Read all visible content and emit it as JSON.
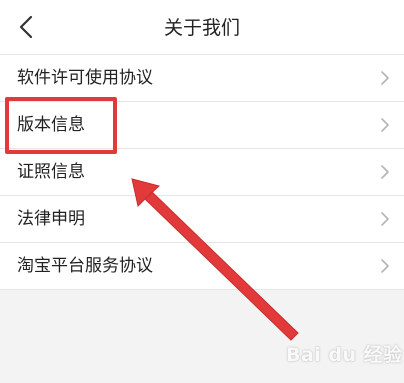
{
  "header": {
    "title": "关于我们",
    "back_icon": "chevron-left-icon"
  },
  "menu": {
    "items": [
      {
        "label": "软件许可使用协议",
        "icon": "chevron-right-icon"
      },
      {
        "label": "版本信息",
        "icon": "chevron-right-icon"
      },
      {
        "label": "证照信息",
        "icon": "chevron-right-icon"
      },
      {
        "label": "法律申明",
        "icon": "chevron-right-icon"
      },
      {
        "label": "淘宝平台服务协议",
        "icon": "chevron-right-icon"
      }
    ]
  },
  "annotation": {
    "highlight_color": "#e23a3a",
    "arrow_color": "#e23a3a"
  },
  "watermark": {
    "text": "Bai du 经验"
  }
}
